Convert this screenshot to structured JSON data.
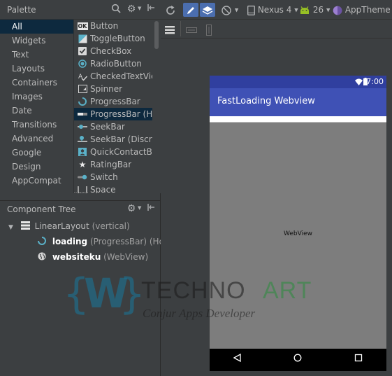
{
  "palette": {
    "title": "Palette",
    "categories": [
      "All",
      "Widgets",
      "Text",
      "Layouts",
      "Containers",
      "Images",
      "Date",
      "Transitions",
      "Advanced",
      "Google",
      "Design",
      "AppCompat"
    ],
    "selected_category": "All",
    "widgets": [
      {
        "label": "Button",
        "icon": "ok-button-icon"
      },
      {
        "label": "ToggleButton",
        "icon": "toggle-button-icon"
      },
      {
        "label": "CheckBox",
        "icon": "checkbox-icon"
      },
      {
        "label": "RadioButton",
        "icon": "radio-button-icon"
      },
      {
        "label": "CheckedTextView",
        "icon": "checked-text-view-icon"
      },
      {
        "label": "Spinner",
        "icon": "spinner-icon"
      },
      {
        "label": "ProgressBar",
        "icon": "progress-bar-icon"
      },
      {
        "label": "ProgressBar (Horizontal)",
        "icon": "progress-bar-horizontal-icon"
      },
      {
        "label": "SeekBar",
        "icon": "seekbar-icon"
      },
      {
        "label": "SeekBar (Discrete)",
        "icon": "seekbar-discrete-icon"
      },
      {
        "label": "QuickContactBadge",
        "icon": "quick-contact-badge-icon"
      },
      {
        "label": "RatingBar",
        "icon": "star-icon"
      },
      {
        "label": "Switch",
        "icon": "switch-icon"
      },
      {
        "label": "Space",
        "icon": "space-icon"
      }
    ]
  },
  "component_tree": {
    "title": "Component Tree",
    "root": {
      "name": "LinearLayout",
      "detail": "(vertical)"
    },
    "children": [
      {
        "id": "loading",
        "detail": "(ProgressBar) (Horizontal)"
      },
      {
        "id": "websiteku",
        "detail": "(WebView)"
      }
    ]
  },
  "toolbar": {
    "device": "Nexus 4",
    "api_level": "26",
    "theme": "AppTheme"
  },
  "preview": {
    "status_time": "7:00",
    "app_title": "FastLoading Webview",
    "webview_label": "WebView"
  },
  "watermark": {
    "brand_letter": "W",
    "brand_main": "TECHNO",
    "brand_accent": "ART",
    "tagline": "Conjur Apps Developer"
  },
  "colors": {
    "ide_background": "#3c3f41",
    "selection": "#0d293e",
    "status_bar": "#303f9f",
    "app_bar": "#3f51b5",
    "webview": "#7d7d7d"
  }
}
